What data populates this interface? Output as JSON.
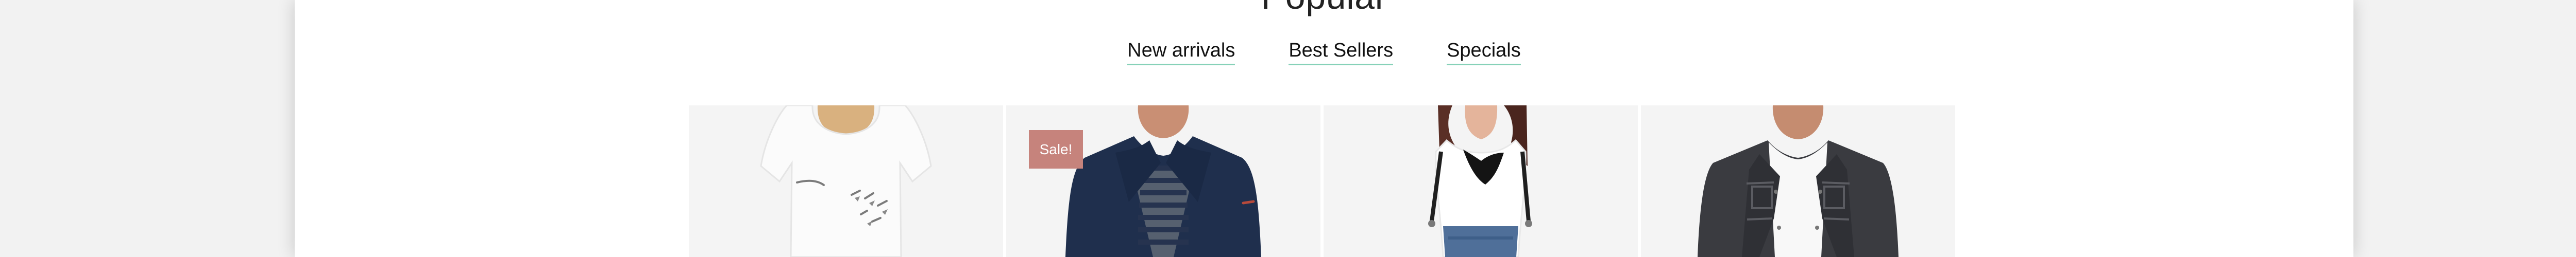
{
  "section": {
    "title": "Popular"
  },
  "tabs": [
    {
      "label": "New arrivals"
    },
    {
      "label": "Best Sellers"
    },
    {
      "label": "Specials"
    }
  ],
  "products": [
    {
      "image": "white-tshirt-product-image",
      "sale": false
    },
    {
      "image": "navy-jacket-product-image",
      "sale": true,
      "badge": "Sale!"
    },
    {
      "image": "white-top-suspenders-product-image",
      "sale": false
    },
    {
      "image": "charcoal-denim-jacket-product-image",
      "sale": false
    }
  ],
  "colors": {
    "accent_underline": "#86d1b8",
    "sale_badge": "#c6837c",
    "card_background": "#f4f4f4"
  }
}
